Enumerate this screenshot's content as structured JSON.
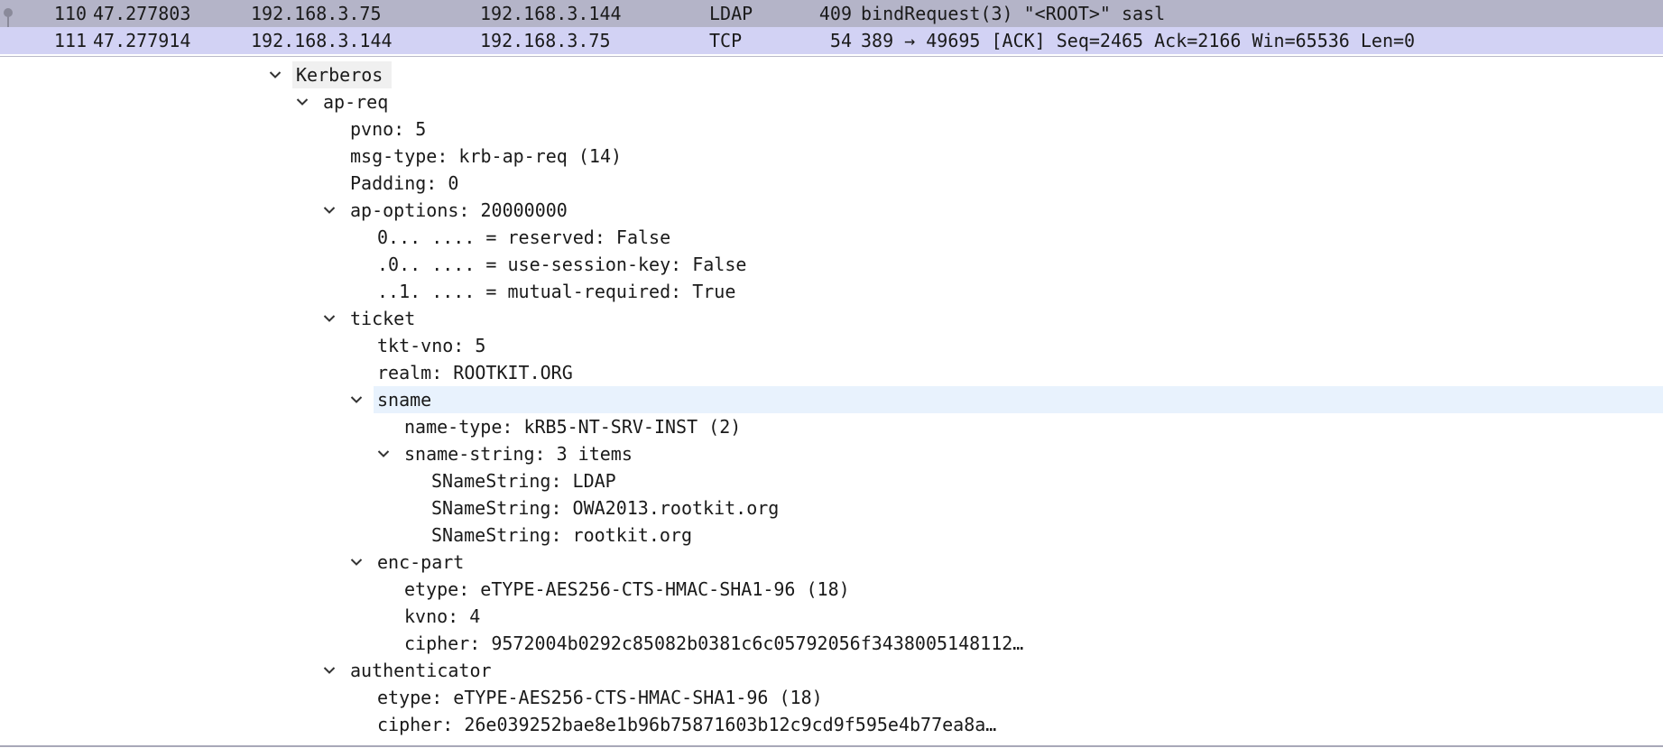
{
  "packets": [
    {
      "no": "110",
      "time": "47.277803",
      "source": "192.168.3.75",
      "destination": "192.168.3.144",
      "protocol": "LDAP",
      "length": "409",
      "info": "bindRequest(3) \"<ROOT>\" sasl"
    },
    {
      "no": "111",
      "time": "47.277914",
      "source": "192.168.3.144",
      "destination": "192.168.3.75",
      "protocol": "TCP",
      "length": "54",
      "info": "389 → 49695 [ACK] Seq=2465 Ack=2166 Win=65536 Len=0"
    }
  ],
  "tree": [
    {
      "text": "Kerberos",
      "level": 0,
      "expanded": true
    },
    {
      "text": "ap-req",
      "level": 1,
      "expanded": true
    },
    {
      "text": "pvno: 5",
      "level": 2
    },
    {
      "text": "msg-type: krb-ap-req (14)",
      "level": 2
    },
    {
      "text": "Padding: 0",
      "level": 2
    },
    {
      "text": "ap-options: 20000000",
      "level": 2,
      "expanded": true
    },
    {
      "text": "0... .... = reserved: False",
      "level": 3
    },
    {
      "text": ".0.. .... = use-session-key: False",
      "level": 3
    },
    {
      "text": "..1. .... = mutual-required: True",
      "level": 3
    },
    {
      "text": "ticket",
      "level": 2,
      "expanded": true
    },
    {
      "text": "tkt-vno: 5",
      "level": 3
    },
    {
      "text": "realm: ROOTKIT.ORG",
      "level": 3
    },
    {
      "text": "sname",
      "level": 3,
      "expanded": true,
      "selected": true
    },
    {
      "text": "name-type: kRB5-NT-SRV-INST (2)",
      "level": 4
    },
    {
      "text": "sname-string: 3 items",
      "level": 4,
      "expanded": true
    },
    {
      "text": "SNameString: LDAP",
      "level": 5
    },
    {
      "text": "SNameString: OWA2013.rootkit.org",
      "level": 5
    },
    {
      "text": "SNameString: rootkit.org",
      "level": 5
    },
    {
      "text": "enc-part",
      "level": 3,
      "expanded": true
    },
    {
      "text": "etype: eTYPE-AES256-CTS-HMAC-SHA1-96 (18)",
      "level": 4
    },
    {
      "text": "kvno: 4",
      "level": 4
    },
    {
      "text": "cipher: 9572004b0292c85082b0381c6c05792056f3438005148112…",
      "level": 4
    },
    {
      "text": "authenticator",
      "level": 2,
      "expanded": true
    },
    {
      "text": "etype: eTYPE-AES256-CTS-HMAC-SHA1-96 (18)",
      "level": 3
    },
    {
      "text": "cipher: 26e039252bae8e1b96b75871603b12c9cd9f595e4b77ea8a…",
      "level": 3
    }
  ],
  "colors": {
    "packet_row_selected": "#b4b4c8",
    "packet_row_alt": "#d2d2f4",
    "tree_selected": "#e8f2fd",
    "tree_root": "#f0f0f0"
  }
}
